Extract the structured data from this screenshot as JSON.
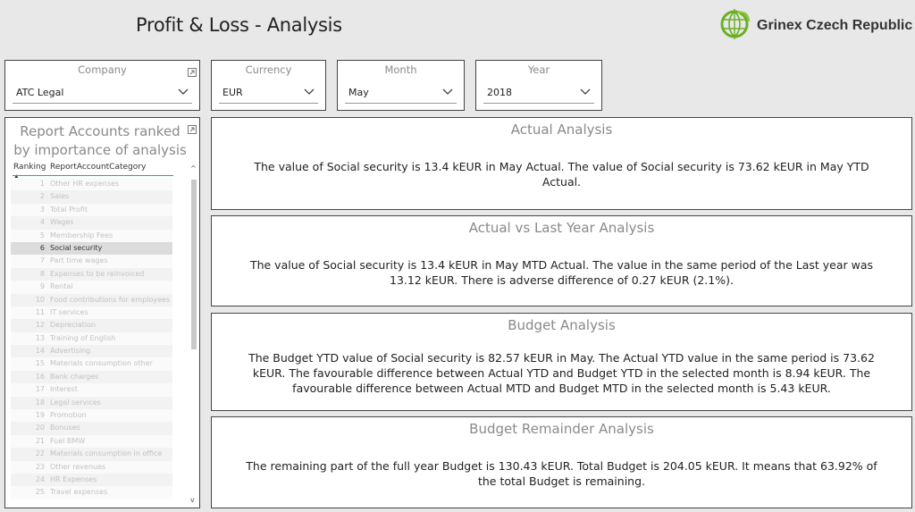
{
  "page_title": "Profit & Loss - Analysis",
  "logo_text": "Grinex Czech Republic",
  "accent_color": "#6ab023",
  "slicers": {
    "company": {
      "label": "Company",
      "value": "ATC Legal"
    },
    "currency": {
      "label": "Currency",
      "value": "EUR"
    },
    "month": {
      "label": "Month",
      "value": "May"
    },
    "year": {
      "label": "Year",
      "value": "2018"
    }
  },
  "ranking_panel": {
    "title": "Report Accounts ranked by importance of analysis",
    "col_ranking": "Ranking",
    "col_category": "ReportAccountCategory",
    "selected_rank": "6",
    "rows": [
      {
        "rank": "1",
        "name": "Other HR expenses"
      },
      {
        "rank": "2",
        "name": "Sales"
      },
      {
        "rank": "3",
        "name": "Total Profit"
      },
      {
        "rank": "4",
        "name": "Wages"
      },
      {
        "rank": "5",
        "name": "Membership Fees"
      },
      {
        "rank": "6",
        "name": "Social security"
      },
      {
        "rank": "7",
        "name": "Part time wages"
      },
      {
        "rank": "8",
        "name": "Expenses to be reinvoiced"
      },
      {
        "rank": "9",
        "name": "Rental"
      },
      {
        "rank": "10",
        "name": "Food contributions for employees"
      },
      {
        "rank": "11",
        "name": "IT services"
      },
      {
        "rank": "12",
        "name": "Depreciation"
      },
      {
        "rank": "13",
        "name": "Training of English"
      },
      {
        "rank": "14",
        "name": "Advertising"
      },
      {
        "rank": "15",
        "name": "Materials consumption other"
      },
      {
        "rank": "16",
        "name": "Bank charges"
      },
      {
        "rank": "17",
        "name": "Interest"
      },
      {
        "rank": "18",
        "name": "Legal services"
      },
      {
        "rank": "19",
        "name": "Promotion"
      },
      {
        "rank": "20",
        "name": "Bonuses"
      },
      {
        "rank": "21",
        "name": "Fuel BMW"
      },
      {
        "rank": "22",
        "name": "Materials consumption in office"
      },
      {
        "rank": "23",
        "name": "Other revenues"
      },
      {
        "rank": "24",
        "name": "HR Expenses"
      },
      {
        "rank": "25",
        "name": "Travel expenses"
      }
    ]
  },
  "cards": {
    "actual": {
      "title": "Actual Analysis",
      "text": "The value of Social security is 13.4 kEUR in May Actual. The value of Social security is 73.62 kEUR in May YTD Actual."
    },
    "actual_vs_ly": {
      "title": "Actual vs Last Year Analysis",
      "text": "The value of Social security is 13.4 kEUR in May MTD Actual. The value in the same period of the Last year was 13.12 kEUR. There is adverse difference of 0.27 kEUR (2.1%)."
    },
    "budget": {
      "title": "Budget Analysis",
      "text": "The Budget YTD value of Social security is 82.57 kEUR in May. The Actual YTD value in the same period is 73.62 kEUR. The favourable difference between Actual YTD and Budget YTD in the selected month is 8.94 kEUR. The favourable difference between Actual MTD and Budget MTD in the selected month is 5.43 kEUR."
    },
    "budget_remainder": {
      "title": "Budget Remainder Analysis",
      "text": "The remaining part of the full year Budget is 130.43 kEUR. Total Budget is 204.05 kEUR. It means that 63.92% of the total Budget is remaining."
    }
  }
}
